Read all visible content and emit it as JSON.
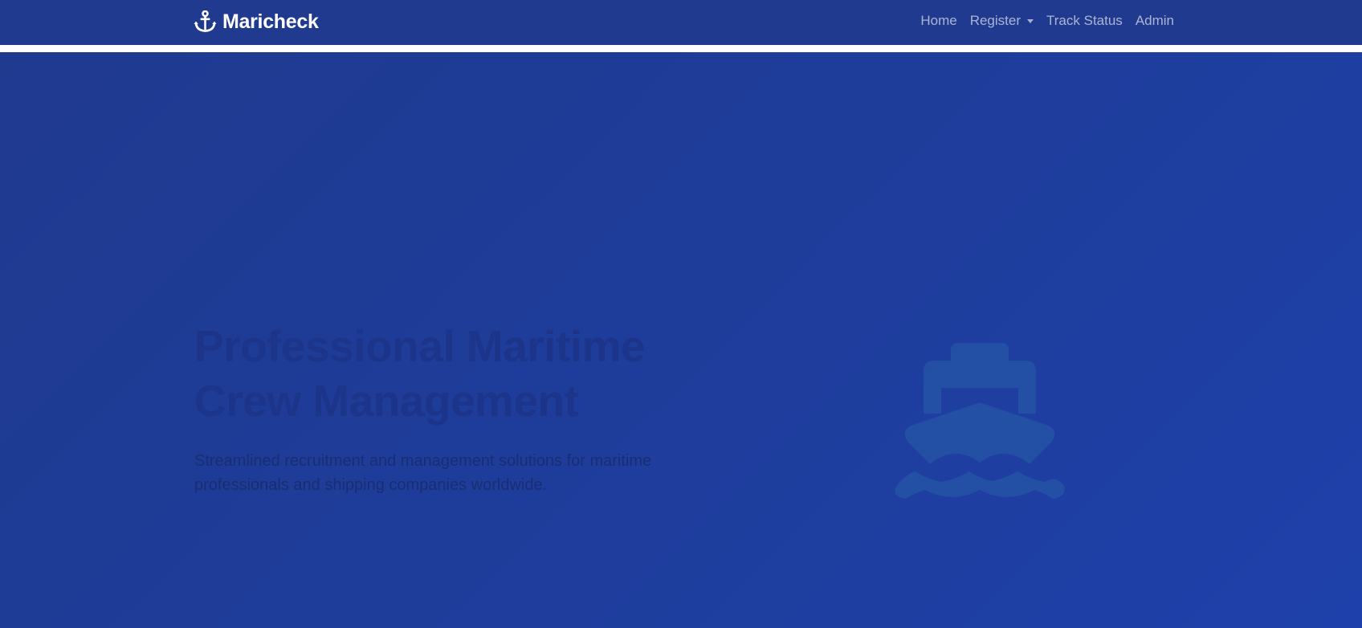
{
  "brand": {
    "name": "Maricheck",
    "icon": "anchor-icon"
  },
  "nav": {
    "home": "Home",
    "register": "Register",
    "track_status": "Track Status",
    "admin": "Admin"
  },
  "hero": {
    "title_line1": "Professional Maritime",
    "title_line2": "Crew Management",
    "subtitle_line1": "Streamlined recruitment and management solutions for maritime",
    "subtitle_line2": "professionals and shipping companies worldwide.",
    "illustration_icon": "ship-icon"
  },
  "colors": {
    "navbar": "#1f3a8f",
    "hero_start": "#1f3a8f",
    "hero_end": "#1e40aa",
    "title_text": "#1c3489",
    "subtitle_text": "#182e72",
    "ship_icon": "#2452a6"
  }
}
